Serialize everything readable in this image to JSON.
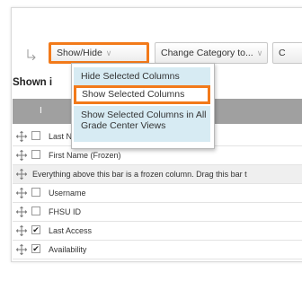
{
  "toolbar": {
    "show_hide_label": "Show/Hide",
    "change_category_label": "Change Category to...",
    "more_label": "C"
  },
  "shown_label": "Shown i",
  "menu": {
    "items": [
      {
        "label": "Hide Selected Columns"
      },
      {
        "label": "Show Selected Columns"
      },
      {
        "label": "Show Selected Columns in All Grade Center Views"
      }
    ]
  },
  "table": {
    "header_letter": "I",
    "rows": [
      {
        "label": "Last Name (Frozen)",
        "checked": false
      },
      {
        "label": "First Name (Frozen)",
        "checked": false
      },
      {
        "label": "Everything above this bar is a frozen column. Drag this bar t",
        "frozen_bar": true
      },
      {
        "label": "Username",
        "checked": false
      },
      {
        "label": "FHSU ID",
        "checked": false
      },
      {
        "label": "Last Access",
        "checked": true
      },
      {
        "label": "Availability",
        "checked": true
      }
    ]
  },
  "colors": {
    "highlight_orange": "#f27a1a",
    "menu_item_bg": "#d7ebf3",
    "header_bg": "#a0a0a0"
  }
}
